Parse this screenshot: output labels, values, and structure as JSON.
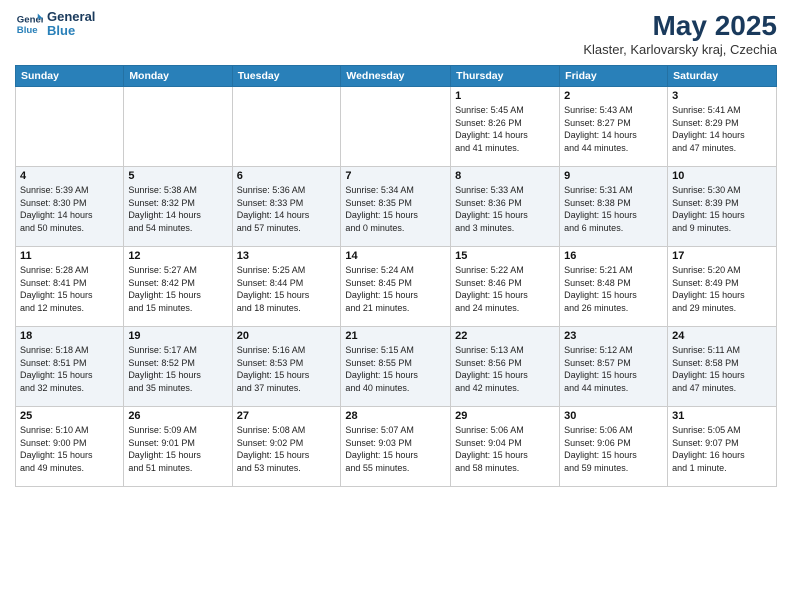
{
  "header": {
    "logo": {
      "line1": "General",
      "line2": "Blue"
    },
    "title": "May 2025",
    "subtitle": "Klaster, Karlovarsky kraj, Czechia"
  },
  "weekdays": [
    "Sunday",
    "Monday",
    "Tuesday",
    "Wednesday",
    "Thursday",
    "Friday",
    "Saturday"
  ],
  "weeks": [
    [
      {
        "day": "",
        "info": ""
      },
      {
        "day": "",
        "info": ""
      },
      {
        "day": "",
        "info": ""
      },
      {
        "day": "",
        "info": ""
      },
      {
        "day": "1",
        "info": "Sunrise: 5:45 AM\nSunset: 8:26 PM\nDaylight: 14 hours\nand 41 minutes."
      },
      {
        "day": "2",
        "info": "Sunrise: 5:43 AM\nSunset: 8:27 PM\nDaylight: 14 hours\nand 44 minutes."
      },
      {
        "day": "3",
        "info": "Sunrise: 5:41 AM\nSunset: 8:29 PM\nDaylight: 14 hours\nand 47 minutes."
      }
    ],
    [
      {
        "day": "4",
        "info": "Sunrise: 5:39 AM\nSunset: 8:30 PM\nDaylight: 14 hours\nand 50 minutes."
      },
      {
        "day": "5",
        "info": "Sunrise: 5:38 AM\nSunset: 8:32 PM\nDaylight: 14 hours\nand 54 minutes."
      },
      {
        "day": "6",
        "info": "Sunrise: 5:36 AM\nSunset: 8:33 PM\nDaylight: 14 hours\nand 57 minutes."
      },
      {
        "day": "7",
        "info": "Sunrise: 5:34 AM\nSunset: 8:35 PM\nDaylight: 15 hours\nand 0 minutes."
      },
      {
        "day": "8",
        "info": "Sunrise: 5:33 AM\nSunset: 8:36 PM\nDaylight: 15 hours\nand 3 minutes."
      },
      {
        "day": "9",
        "info": "Sunrise: 5:31 AM\nSunset: 8:38 PM\nDaylight: 15 hours\nand 6 minutes."
      },
      {
        "day": "10",
        "info": "Sunrise: 5:30 AM\nSunset: 8:39 PM\nDaylight: 15 hours\nand 9 minutes."
      }
    ],
    [
      {
        "day": "11",
        "info": "Sunrise: 5:28 AM\nSunset: 8:41 PM\nDaylight: 15 hours\nand 12 minutes."
      },
      {
        "day": "12",
        "info": "Sunrise: 5:27 AM\nSunset: 8:42 PM\nDaylight: 15 hours\nand 15 minutes."
      },
      {
        "day": "13",
        "info": "Sunrise: 5:25 AM\nSunset: 8:44 PM\nDaylight: 15 hours\nand 18 minutes."
      },
      {
        "day": "14",
        "info": "Sunrise: 5:24 AM\nSunset: 8:45 PM\nDaylight: 15 hours\nand 21 minutes."
      },
      {
        "day": "15",
        "info": "Sunrise: 5:22 AM\nSunset: 8:46 PM\nDaylight: 15 hours\nand 24 minutes."
      },
      {
        "day": "16",
        "info": "Sunrise: 5:21 AM\nSunset: 8:48 PM\nDaylight: 15 hours\nand 26 minutes."
      },
      {
        "day": "17",
        "info": "Sunrise: 5:20 AM\nSunset: 8:49 PM\nDaylight: 15 hours\nand 29 minutes."
      }
    ],
    [
      {
        "day": "18",
        "info": "Sunrise: 5:18 AM\nSunset: 8:51 PM\nDaylight: 15 hours\nand 32 minutes."
      },
      {
        "day": "19",
        "info": "Sunrise: 5:17 AM\nSunset: 8:52 PM\nDaylight: 15 hours\nand 35 minutes."
      },
      {
        "day": "20",
        "info": "Sunrise: 5:16 AM\nSunset: 8:53 PM\nDaylight: 15 hours\nand 37 minutes."
      },
      {
        "day": "21",
        "info": "Sunrise: 5:15 AM\nSunset: 8:55 PM\nDaylight: 15 hours\nand 40 minutes."
      },
      {
        "day": "22",
        "info": "Sunrise: 5:13 AM\nSunset: 8:56 PM\nDaylight: 15 hours\nand 42 minutes."
      },
      {
        "day": "23",
        "info": "Sunrise: 5:12 AM\nSunset: 8:57 PM\nDaylight: 15 hours\nand 44 minutes."
      },
      {
        "day": "24",
        "info": "Sunrise: 5:11 AM\nSunset: 8:58 PM\nDaylight: 15 hours\nand 47 minutes."
      }
    ],
    [
      {
        "day": "25",
        "info": "Sunrise: 5:10 AM\nSunset: 9:00 PM\nDaylight: 15 hours\nand 49 minutes."
      },
      {
        "day": "26",
        "info": "Sunrise: 5:09 AM\nSunset: 9:01 PM\nDaylight: 15 hours\nand 51 minutes."
      },
      {
        "day": "27",
        "info": "Sunrise: 5:08 AM\nSunset: 9:02 PM\nDaylight: 15 hours\nand 53 minutes."
      },
      {
        "day": "28",
        "info": "Sunrise: 5:07 AM\nSunset: 9:03 PM\nDaylight: 15 hours\nand 55 minutes."
      },
      {
        "day": "29",
        "info": "Sunrise: 5:06 AM\nSunset: 9:04 PM\nDaylight: 15 hours\nand 58 minutes."
      },
      {
        "day": "30",
        "info": "Sunrise: 5:06 AM\nSunset: 9:06 PM\nDaylight: 15 hours\nand 59 minutes."
      },
      {
        "day": "31",
        "info": "Sunrise: 5:05 AM\nSunset: 9:07 PM\nDaylight: 16 hours\nand 1 minute."
      }
    ]
  ]
}
